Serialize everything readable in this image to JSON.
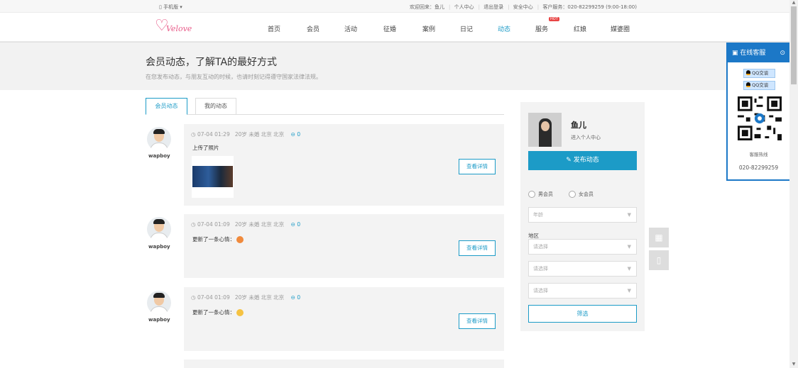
{
  "topbar": {
    "mobile": "▯ 手机版 ▾",
    "welcome": "欢迎回来：鱼儿",
    "personal_center": "个人中心",
    "logout": "退出登录",
    "security": "安全中心",
    "service": "客户服务：020-82299259 (9:00-18:00)"
  },
  "logo": {
    "text": "Velove"
  },
  "nav": {
    "items": [
      "首页",
      "会员",
      "活动",
      "征婚",
      "案例",
      "日记",
      "动态",
      "服务",
      "红娘",
      "媒婆圈"
    ],
    "active": "动态",
    "hot_badge": "HOT"
  },
  "banner": {
    "title": "会员动态，了解TA的最好方式",
    "subtitle": "在您发布动态，与朋友互动的时候，也请时刻记得遵守国家法律法规。"
  },
  "tabs": [
    "会员动态",
    "我的动态"
  ],
  "feed": [
    {
      "user": "wapboy",
      "time": "07-04 01:29",
      "info": "20岁 未婚 北京 北京",
      "comments": "0",
      "text": "上传了照片",
      "has_photo": true,
      "emoji_color": ""
    },
    {
      "user": "wapboy",
      "time": "07-04 01:09",
      "info": "20岁 未婚 北京 北京",
      "comments": "0",
      "text": "更新了一条心情：",
      "has_photo": false,
      "emoji_color": "#f08a3c"
    },
    {
      "user": "wapboy",
      "time": "07-04 01:09",
      "info": "20岁 未婚 北京 北京",
      "comments": "0",
      "text": "更新了一条心情：",
      "has_photo": false,
      "emoji_color": "#f5c242"
    }
  ],
  "feed_common": {
    "detail_label": "查看详情",
    "comment_icon": "⊖"
  },
  "sidebar": {
    "name": "鱼儿",
    "center_link": "进入个人中心",
    "post_button": "发布动态",
    "male": "男会员",
    "female": "女会员",
    "age_placeholder": "年龄",
    "area_label": "地区",
    "select_placeholder": "请选择",
    "filter_button": "筛选"
  },
  "service_panel": {
    "title": "在线客服",
    "qq_label": "QQ交谈",
    "hotline_label": "客服热线",
    "hotline": "020-82299259"
  },
  "colors": {
    "accent": "#1c9bc7",
    "brand": "#e85a88",
    "service": "#1c78c7"
  }
}
